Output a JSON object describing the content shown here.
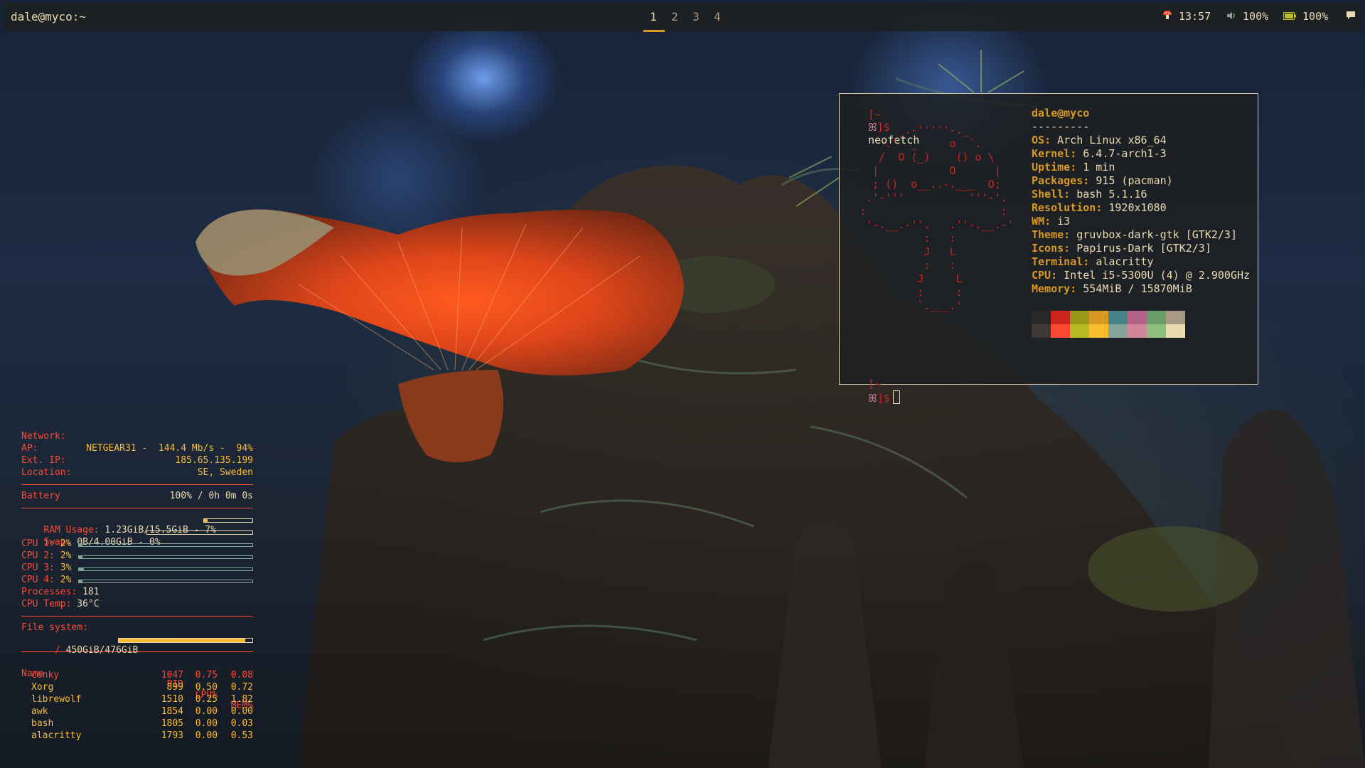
{
  "topbar": {
    "title": "dale@myco:~",
    "workspaces": [
      "1",
      "2",
      "3",
      "4"
    ],
    "active_workspace": "1",
    "time": "13:57",
    "volume": "100%",
    "battery": "100%",
    "icons": [
      "mushroom-icon",
      "volume-icon",
      "battery-icon",
      "notification-icon"
    ]
  },
  "terminal": {
    "prompt_open": "[~",
    "prompt_close": "]$",
    "command": "neofetch",
    "user": "dale@myco",
    "divider": "---------",
    "info": [
      {
        "key": "OS",
        "value": "Arch Linux x86_64"
      },
      {
        "key": "Kernel",
        "value": "6.4.7-arch1-3"
      },
      {
        "key": "Uptime",
        "value": "1 min"
      },
      {
        "key": "Packages",
        "value": "915 (pacman)"
      },
      {
        "key": "Shell",
        "value": "bash 5.1.16"
      },
      {
        "key": "Resolution",
        "value": "1920x1080"
      },
      {
        "key": "WM",
        "value": "i3"
      },
      {
        "key": "Theme",
        "value": "gruvbox-dark-gtk [GTK2/3]"
      },
      {
        "key": "Icons",
        "value": "Papirus-Dark [GTK2/3]"
      },
      {
        "key": "Terminal",
        "value": "alacritty"
      },
      {
        "key": "CPU",
        "value": "Intel i5-5300U (4) @ 2.900GHz"
      },
      {
        "key": "Memory",
        "value": "554MiB / 15870MiB"
      }
    ],
    "colors_dark": [
      "#282828",
      "#cc241d",
      "#98971a",
      "#d79921",
      "#458588",
      "#b16286",
      "#689d6a",
      "#a89984"
    ],
    "colors_bright": [
      "#3c3836",
      "#fb4934",
      "#b8bb26",
      "#fabd2f",
      "#83a598",
      "#d3869b",
      "#8ec07c",
      "#ebdbb2"
    ]
  },
  "conky": {
    "network_label": "Network:",
    "ap_label": "AP:",
    "ap_value": "NETGEAR31 -  144.4 Mb/s -  94%",
    "extip_label": "Ext. IP:",
    "extip_value": "185.65.135.199",
    "location_label": "Location:",
    "location_value": "SE, Sweden",
    "battery_label": "Battery",
    "battery_value": "100% / 0h 0m 0s",
    "ram_label": "RAM Usage:",
    "ram_value": "1.23GiB/15.5GiB - 7%",
    "ram_fraction": 0.07,
    "swap_label": "Swap:",
    "swap_value": "0B/4.00GiB - 0%",
    "swap_fraction": 0.0,
    "cpus": [
      {
        "label": "CPU 1:",
        "value": "2%",
        "fraction": 0.02
      },
      {
        "label": "CPU 2:",
        "value": "2%",
        "fraction": 0.02
      },
      {
        "label": "CPU 3:",
        "value": "3%",
        "fraction": 0.03
      },
      {
        "label": "CPU 4:",
        "value": "2%",
        "fraction": 0.02
      }
    ],
    "processes_label": "Processes:",
    "processes_value": "181",
    "temp_label": "CPU Temp:",
    "temp_value": "36°C",
    "fs_label": "File system:",
    "fs_mount": "/",
    "fs_value": "450GiB/476GiB",
    "fs_fraction": 0.945,
    "proc_headers": [
      "Name",
      "PID",
      "CPU%",
      "MEM%"
    ],
    "procs": [
      [
        "conky",
        "1047",
        "0.75",
        "0.08"
      ],
      [
        "Xorg",
        "899",
        "0.50",
        "0.72"
      ],
      [
        "librewolf",
        "1510",
        "0.25",
        "1.82"
      ],
      [
        "awk",
        "1854",
        "0.00",
        "0.00"
      ],
      [
        "bash",
        "1805",
        "0.00",
        "0.03"
      ],
      [
        "alacritty",
        "1793",
        "0.00",
        "0.53"
      ]
    ]
  }
}
